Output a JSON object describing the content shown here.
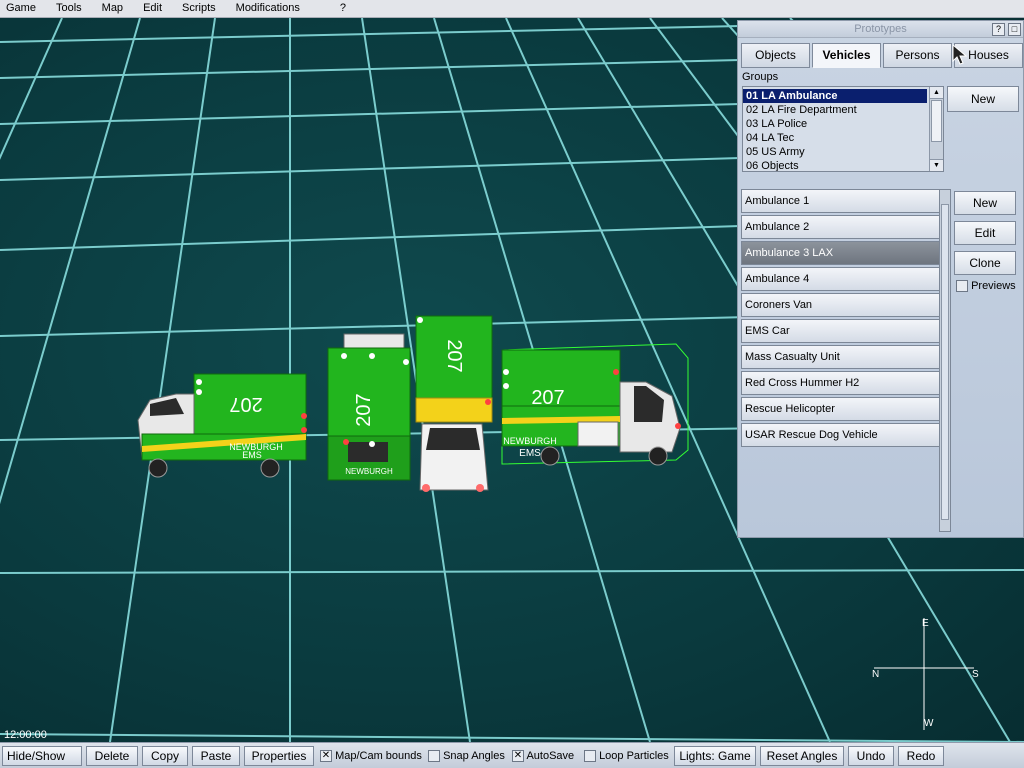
{
  "menu": [
    {
      "label": "Game"
    },
    {
      "label": "Tools"
    },
    {
      "label": "Map"
    },
    {
      "label": "Edit"
    },
    {
      "label": "Scripts"
    },
    {
      "label": "Modifications"
    },
    {
      "label": "?"
    }
  ],
  "prototypes": {
    "title": "Prototypes",
    "help_button": "?",
    "tabs": [
      "Objects",
      "Vehicles",
      "Persons",
      "Houses"
    ],
    "active_tab": "Vehicles",
    "groups_label": "Groups",
    "groups": [
      "01 LA Ambulance",
      "02 LA Fire Department",
      "03 LA Police",
      "04 LA Tec",
      "05 US Army",
      "06 Objects"
    ],
    "selected_group": "01 LA Ambulance",
    "group_new_button": "New",
    "items": [
      "Ambulance 1",
      "Ambulance 2",
      "Ambulance 3 LAX",
      "Ambulance 4",
      "Coroners Van",
      "EMS Car",
      "Mass Casualty Unit",
      "Red Cross Hummer H2",
      "Rescue Helicopter",
      "USAR Rescue Dog Vehicle"
    ],
    "selected_item": "Ambulance 3 LAX",
    "item_buttons": {
      "new": "New",
      "edit": "Edit",
      "clone": "Clone"
    },
    "previews_label": "Previews",
    "previews_checked": false
  },
  "scene": {
    "vehicle_number": "207",
    "vehicle_label": "NEWBURGH",
    "vehicle_label2": "EMS",
    "colors": {
      "grid_line": "#8fe6e6",
      "background": "#0b3b3f",
      "vehicle_green": "#22b51e"
    }
  },
  "compass": {
    "north": "N",
    "east": "E",
    "south": "S",
    "west": "W"
  },
  "clock": "12:00:00",
  "toolbar": {
    "hide_show": "Hide/Show",
    "delete": "Delete",
    "copy": "Copy",
    "paste": "Paste",
    "properties": "Properties",
    "map_cam_bounds": "Map/Cam bounds",
    "map_cam_bounds_checked": true,
    "snap_angles": "Snap Angles",
    "snap_angles_checked": false,
    "autosave": "AutoSave",
    "autosave_checked": true,
    "loop_particles": "Loop Particles",
    "loop_particles_checked": false,
    "lights": "Lights: Game",
    "reset_angles": "Reset Angles",
    "undo": "Undo",
    "redo": "Redo"
  }
}
